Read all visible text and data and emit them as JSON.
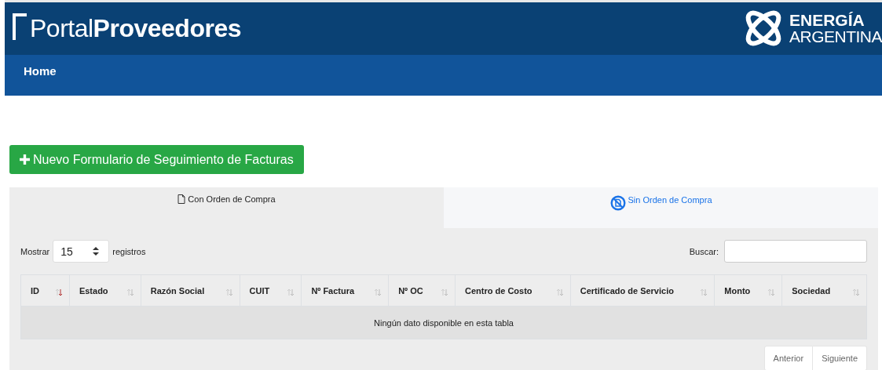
{
  "header": {
    "brand_light": "Portal",
    "brand_bold": "Proveedores",
    "partner_line1": "ENERGÍA",
    "partner_line2": "ARGENTINA"
  },
  "nav": {
    "items": [
      {
        "label": "Home",
        "selected": true
      }
    ]
  },
  "new_button": {
    "label": "Nuevo Formulario de Seguimiento de Facturas"
  },
  "tabs": [
    {
      "label": "Con Orden de Compra",
      "kind": "file",
      "selected": true
    },
    {
      "label": "Sin Orden de Compra",
      "kind": "blocked",
      "selected": false
    }
  ],
  "length": {
    "prefix": "Mostrar",
    "value": "15",
    "suffix": "registros"
  },
  "search": {
    "label": "Buscar:"
  },
  "table": {
    "columns": [
      {
        "label": "ID",
        "sorted": true
      },
      {
        "label": "Estado",
        "sorted": false
      },
      {
        "label": "Razón Social",
        "sorted": false
      },
      {
        "label": "CUIT",
        "sorted": false
      },
      {
        "label": "Nº Factura",
        "sorted": false
      },
      {
        "label": "Nº OC",
        "sorted": false
      },
      {
        "label": "Centro de Costo",
        "sorted": false
      },
      {
        "label": "Certificado de Servicio",
        "sorted": false
      },
      {
        "label": "Monto",
        "sorted": false
      },
      {
        "label": "Sociedad",
        "sorted": false
      }
    ],
    "empty": "Ningún dato disponible en esta tabla"
  },
  "pagination": {
    "previous": "Anterior",
    "next": "Siguiente"
  }
}
